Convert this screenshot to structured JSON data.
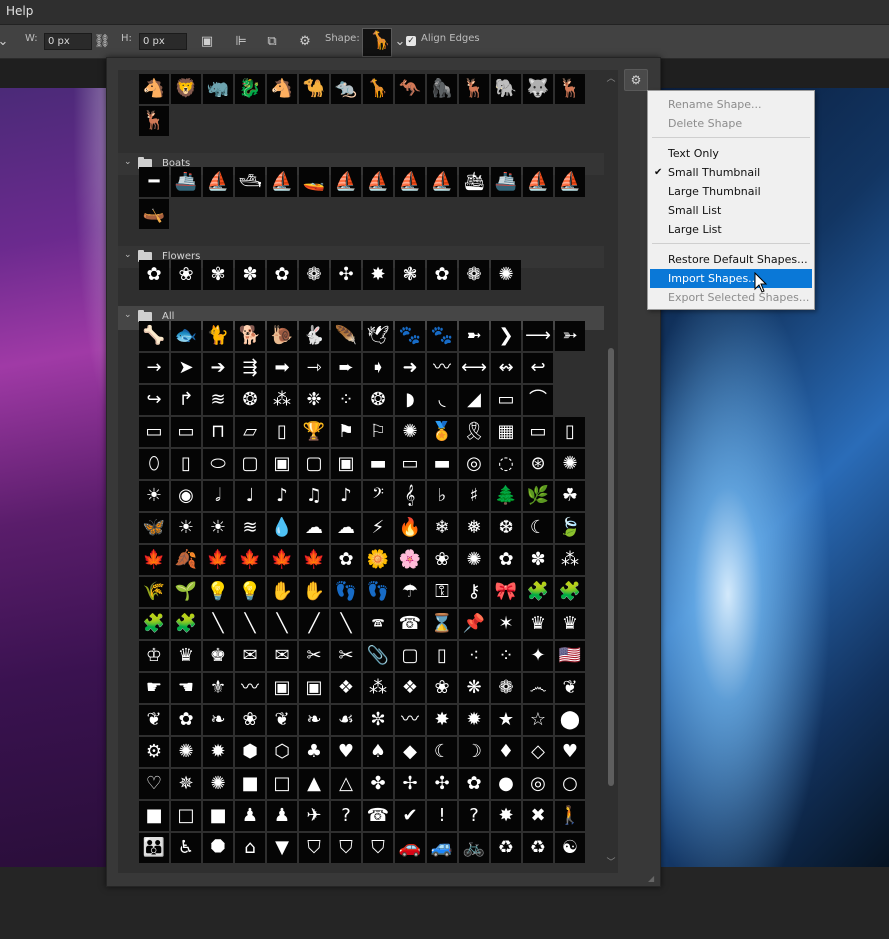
{
  "menubar": {
    "help": "Help"
  },
  "options": {
    "w_label": "W:",
    "w_value": "0 px",
    "h_label": "H:",
    "h_value": "0 px",
    "shape_label": "Shape:",
    "align_edges_label": "Align Edges",
    "align_edges_checked": true
  },
  "groups": {
    "boats": "Boats",
    "flowers": "Flowers",
    "all": "All"
  },
  "tiles": {
    "animals": [
      "🐴",
      "🦁",
      "🦏",
      "🐉",
      "🐴",
      "🐪",
      "🐀",
      "🦒",
      "🦘",
      "🦍",
      "🦌",
      "🐘",
      "🐺",
      "🦌",
      "🦌"
    ],
    "boats": [
      "━",
      "🚢",
      "⛵",
      "🛥",
      "⛵",
      "🚤",
      "⛵",
      "⛵",
      "⛵",
      "⛵",
      "🛳",
      "🚢",
      "⛵",
      "⛵",
      "🛶"
    ],
    "flowers": [
      "✿",
      "❀",
      "✾",
      "✽",
      "✿",
      "❁",
      "✣",
      "✸",
      "❃",
      "✿",
      "❁",
      "✺"
    ],
    "all": [
      [
        "🦴",
        "🐟",
        "🐈",
        "🐕",
        "🐌",
        "🐇",
        "🪶",
        "🕊",
        "🐾",
        "🐾",
        "➼",
        "❯",
        "⟶",
        "➳"
      ],
      [
        "→",
        "➤",
        "➔",
        "⇶",
        "➡",
        "⇾",
        "➨",
        "➧",
        "➜",
        "〰",
        "⟷",
        "↭",
        "↩"
      ],
      [
        "↪",
        "↱",
        "≋",
        "❂",
        "⁂",
        "❉",
        "⁘",
        "❂",
        "◗",
        "◟",
        "◢",
        "▭",
        "⌒"
      ],
      [
        "▭",
        "▭",
        "⊓",
        "▱",
        "▯",
        "🏆",
        "⚑",
        "⚐",
        "✺",
        "🏅",
        "🎗",
        "▦",
        "▭",
        "▯"
      ],
      [
        "⬯",
        "▯",
        "⬭",
        "▢",
        "▣",
        "▢",
        "▣",
        "▬",
        "▭",
        "▬",
        "◎",
        "◌",
        "⊛",
        "✺"
      ],
      [
        "☀",
        "◉",
        "𝅗𝅥",
        "♩",
        "♪",
        "♫",
        "♪",
        "𝄢",
        "𝄞",
        "♭",
        "♯",
        "🌲",
        "🌿",
        "☘"
      ],
      [
        "🦋",
        "☀",
        "☀",
        "≋",
        "💧",
        "☁",
        "☁",
        "⚡",
        "🔥",
        "❄",
        "❅",
        "❆",
        "☾",
        "🍃"
      ],
      [
        "🍁",
        "🍂",
        "🍁",
        "🍁",
        "🍁",
        "🍁",
        "✿",
        "🌼",
        "🌸",
        "❀",
        "✺",
        "✿",
        "✽",
        "⁂"
      ],
      [
        "🌾",
        "🌱",
        "💡",
        "💡",
        "✋",
        "✋",
        "👣",
        "👣",
        "☂",
        "⚿",
        "⚷",
        "🎀",
        "🧩",
        "🧩"
      ],
      [
        "🧩",
        "🧩",
        "╲",
        "╲",
        "╲",
        "╱",
        "╲",
        "🕿",
        "☎",
        "⌛",
        "📌",
        "✶",
        "♛",
        "♛"
      ],
      [
        "♔",
        "♛",
        "♚",
        "✉",
        "✉",
        "✂",
        "✂",
        "📎",
        "▢",
        "▯",
        "⁖",
        "⁘",
        "✦",
        "🇺🇸"
      ],
      [
        "☛",
        "☚",
        "⚜",
        "〰",
        "▣",
        "▣",
        "❖",
        "⁂",
        "❖",
        "❀",
        "❋",
        "❁",
        "෴",
        "❦"
      ],
      [
        "❦",
        "✿",
        "❧",
        "❀",
        "❦",
        "❧",
        "☙",
        "✼",
        "〰",
        "✸",
        "✹",
        "★",
        "☆",
        "⬤"
      ],
      [
        "⚙",
        "✺",
        "✹",
        "⬢",
        "⬡",
        "♣",
        "♥",
        "♠",
        "◆",
        "☾",
        "☽",
        "♦",
        "◇",
        "♥"
      ],
      [
        "♡",
        "✵",
        "✺",
        "■",
        "□",
        "▲",
        "△",
        "✤",
        "✢",
        "✣",
        "✿",
        "●",
        "◎",
        "○"
      ],
      [
        "■",
        "□",
        "■",
        "♟",
        "♟",
        "✈",
        "?",
        "☎",
        "✔",
        "!",
        "?",
        "✸",
        "✖",
        "🚶"
      ],
      [
        "👪",
        "♿",
        "⯃",
        "⌂",
        "▼",
        "⛉",
        "⛉",
        "⛉",
        "🚗",
        "🚙",
        "🚲",
        "♻",
        "♻",
        "☯"
      ]
    ]
  },
  "context_menu": {
    "items": [
      {
        "label": "Rename Shape...",
        "disabled": true
      },
      {
        "label": "Delete Shape",
        "disabled": true
      },
      {
        "label": "Text Only",
        "disabled": false
      },
      {
        "label": "Small Thumbnail",
        "disabled": false,
        "checked": true
      },
      {
        "label": "Large Thumbnail",
        "disabled": false
      },
      {
        "label": "Small List",
        "disabled": false
      },
      {
        "label": "Large List",
        "disabled": false
      },
      {
        "label": "Restore Default Shapes...",
        "disabled": false
      },
      {
        "label": "Import Shapes...",
        "disabled": false,
        "selected": true
      },
      {
        "label": "Export Selected Shapes...",
        "disabled": true
      }
    ]
  },
  "icons": {
    "gear": "gear-icon",
    "chain": "link-icon",
    "folder": "folder-icon",
    "chevron": "chevron-down-icon"
  }
}
